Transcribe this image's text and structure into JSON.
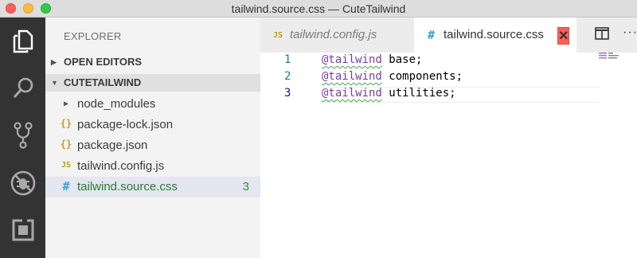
{
  "window": {
    "title": "tailwind.source.css — CuteTailwind"
  },
  "activity_bar": {
    "items": [
      {
        "icon": "files-icon"
      },
      {
        "icon": "search-icon"
      },
      {
        "icon": "source-control-icon"
      },
      {
        "icon": "debug-icon"
      },
      {
        "icon": "extensions-icon"
      }
    ]
  },
  "sidebar": {
    "title": "EXPLORER",
    "sections": {
      "open_editors": "OPEN EDITORS",
      "project": "CUTETAILWIND"
    },
    "files": [
      {
        "name": "node_modules",
        "icon": "folder-chevron-icon",
        "type": "folder"
      },
      {
        "name": "package-lock.json",
        "icon": "json-icon",
        "type": "json"
      },
      {
        "name": "package.json",
        "icon": "json-icon",
        "type": "json"
      },
      {
        "name": "tailwind.config.js",
        "icon": "js-icon",
        "type": "js"
      },
      {
        "name": "tailwind.source.css",
        "icon": "css-icon",
        "type": "css",
        "badge": "3",
        "active": true
      }
    ]
  },
  "tabs": [
    {
      "label": "tailwind.config.js",
      "icon": "js-icon",
      "active": false
    },
    {
      "label": "tailwind.source.css",
      "icon": "css-icon",
      "active": true,
      "close": "✕"
    }
  ],
  "editor": {
    "lines": [
      {
        "number": "1",
        "at": "@tailwind",
        "rest": " base;"
      },
      {
        "number": "2",
        "at": "@tailwind",
        "rest": " components;"
      },
      {
        "number": "3",
        "at": "@tailwind",
        "rest": " utilities;"
      }
    ]
  },
  "colors": {
    "activity_bar": "#333333",
    "sidebar": "#f3f3f3",
    "active_file_bg": "#e4e6f1",
    "badge": "#388a34",
    "squiggle": "#4aa34a"
  }
}
